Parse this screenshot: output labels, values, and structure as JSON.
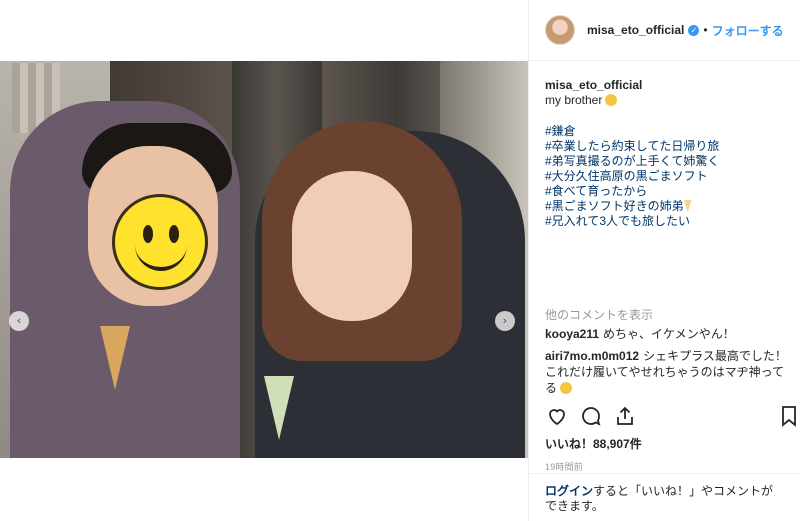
{
  "post": {
    "username": "misa_eto_official",
    "verified_icon": "verified-badge-icon",
    "follow_label": "フォローする",
    "separator": "•",
    "caption_text": "my brother",
    "hashtags": [
      "#鎌倉",
      "#卒業したら約束してた日帰り旅",
      "#弟写真撮るのが上手くて姉驚く",
      "#大分久住高原の黒ごまソフト",
      "#食べて育ったから",
      "#黒ごまソフト好きの姉弟",
      "#兄入れて3人でも旅したい"
    ],
    "more_comments_label": "他のコメントを表示",
    "comments": [
      {
        "user": "kooya211",
        "text": "めちゃ、イケメンやん！"
      },
      {
        "user": "airi7mo.m0m012",
        "text": "シェキプラス最高でした！これだけ履いてやせれちゃうのはマヂ神ってる"
      }
    ],
    "likes_label": "いいね！88,907件",
    "timestamp": "19時間前",
    "login_link": "ログイン",
    "login_text": "すると「いいね！」やコメントができます。"
  },
  "photo": {
    "prev_arrow": "‹",
    "next_arrow": "›"
  },
  "icons": {
    "like": "heart-icon",
    "comment": "comment-icon",
    "share": "share-icon",
    "save": "bookmark-icon"
  },
  "colors": {
    "link": "#003569",
    "follow": "#3897f0",
    "muted": "#999999",
    "text": "#262626"
  }
}
